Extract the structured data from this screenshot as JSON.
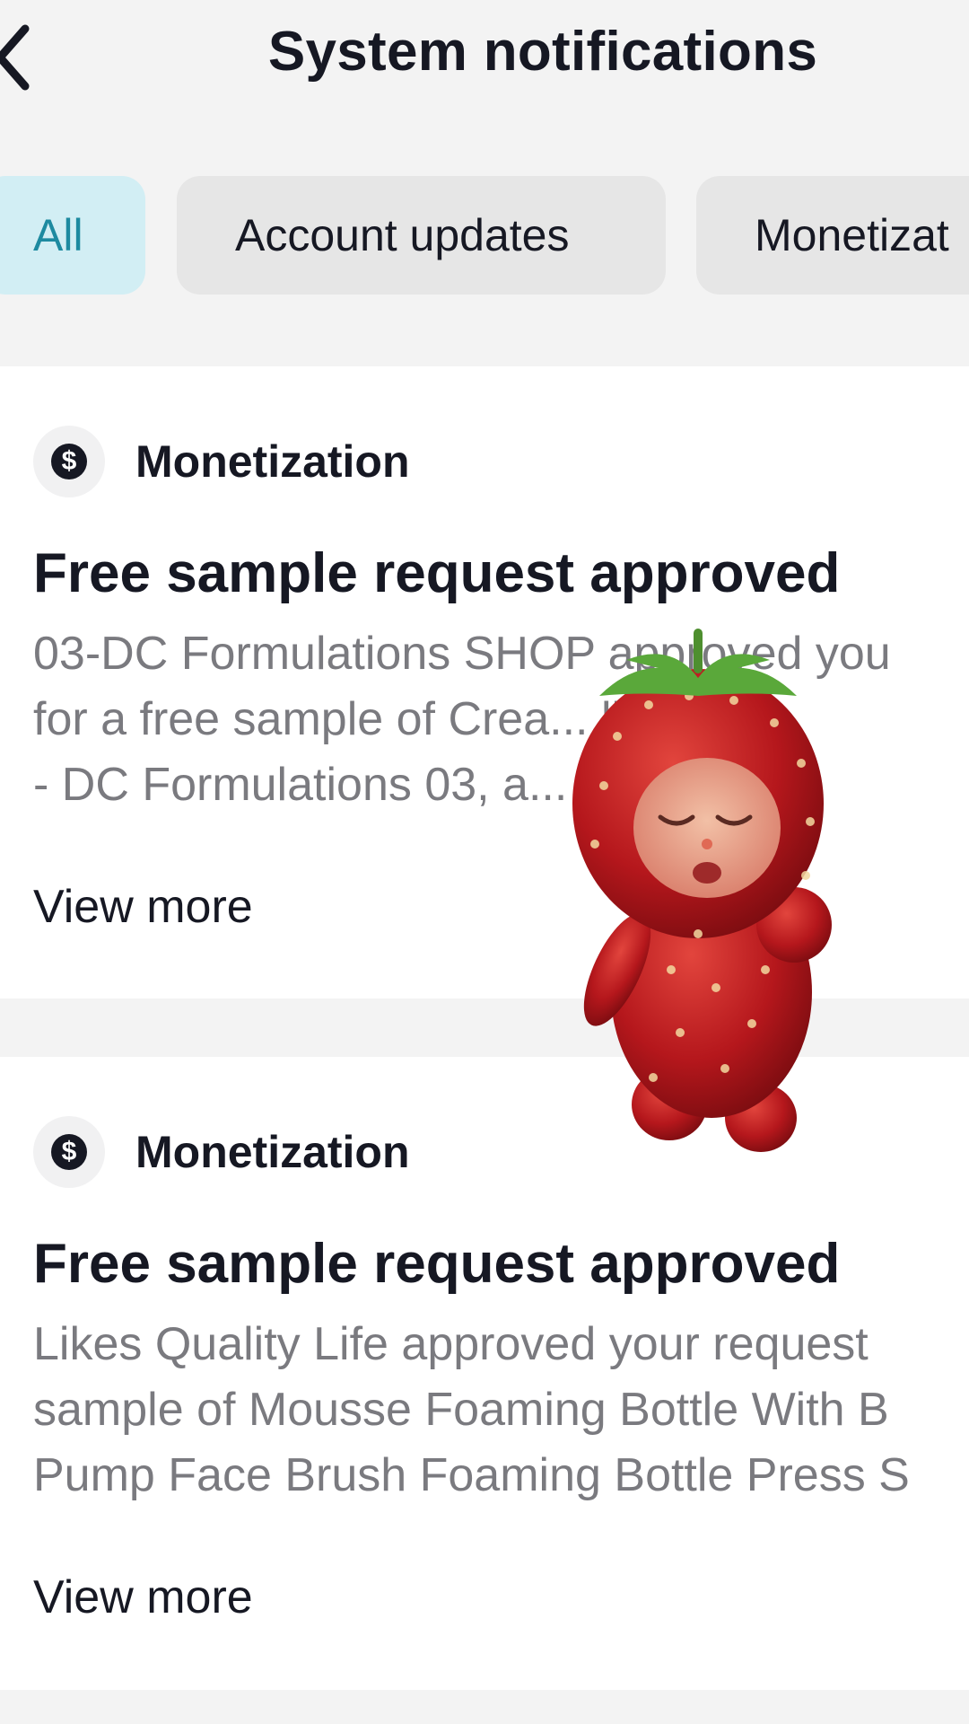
{
  "header": {
    "title": "System notifications",
    "back_icon": "chevron-left-icon"
  },
  "tabs": [
    {
      "label": "All",
      "active": true
    },
    {
      "label": "Account updates",
      "active": false
    },
    {
      "label": "Monetizat",
      "active": false
    }
  ],
  "notifications": [
    {
      "category": "Monetization",
      "category_icon": "dollar-icon",
      "title": "Free sample request approved",
      "body_lines": [
        "03-DC Formulations SHOP approved you",
        "for a free sample of Crea... lighter c",
        "- DC Formulations 03, a... d you a"
      ],
      "view_more": "View more"
    },
    {
      "category": "Monetization",
      "category_icon": "dollar-icon",
      "title": "Free sample request approved",
      "body_lines": [
        "Likes Quality Life approved your request",
        "sample of Mousse Foaming Bottle With B",
        "Pump Face Brush Foaming Bottle Press S"
      ],
      "view_more": "View more"
    }
  ],
  "colors": {
    "background": "#f3f3f3",
    "card": "#ffffff",
    "active_tab_bg": "#d2eef4",
    "active_tab_text": "#1d8aa0",
    "tab_bg": "#e6e6e6",
    "body_text": "#7a7a7f"
  },
  "overlay": {
    "sticker": "strawberry-character-sticker"
  }
}
